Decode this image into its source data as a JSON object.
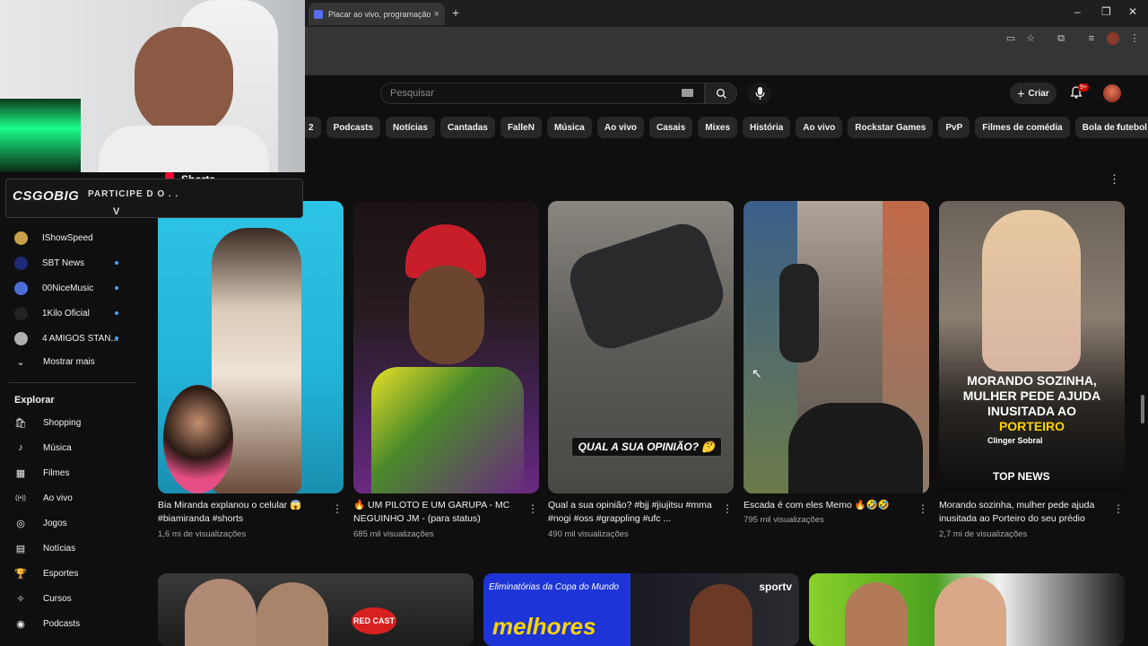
{
  "browser": {
    "tab_title": "Placar ao vivo, programação &",
    "tab_close": "×",
    "new_tab": "+",
    "window_controls": [
      "–",
      "❐",
      "✕"
    ]
  },
  "header": {
    "search_placeholder": "Pesquisar",
    "create_label": "Criar",
    "notification_count": "9+"
  },
  "chips": [
    "2",
    "Podcasts",
    "Notícias",
    "Cantadas",
    "FalleN",
    "Música",
    "Ao vivo",
    "Casais",
    "Mixes",
    "História",
    "Ao vivo",
    "Rockstar Games",
    "PvP",
    "Filmes de comédia",
    "Bola de futebol"
  ],
  "sidebar": {
    "subscriptions": [
      {
        "name": "IShowSpeed",
        "color": "#c9a04a",
        "dot": false
      },
      {
        "name": "SBT News",
        "color": "#1e2a78",
        "dot": true
      },
      {
        "name": "00NiceMusic",
        "color": "#4a6fd8",
        "dot": true
      },
      {
        "name": "1Kilo Oficial",
        "color": "#222222",
        "dot": true
      },
      {
        "name": "4 AMIGOS STAN...",
        "color": "#b0b0b0",
        "dot": true
      }
    ],
    "show_more": "Mostrar mais",
    "explore_heading": "Explorar",
    "explore_items": [
      {
        "label": "Shopping",
        "icon": "shopping-bag-icon",
        "glyph": "🛍"
      },
      {
        "label": "Música",
        "icon": "music-note-icon",
        "glyph": "♪"
      },
      {
        "label": "Filmes",
        "icon": "film-icon",
        "glyph": "▦"
      },
      {
        "label": "Ao vivo",
        "icon": "live-icon",
        "glyph": "((•))"
      },
      {
        "label": "Jogos",
        "icon": "gamepad-icon",
        "glyph": "◎"
      },
      {
        "label": "Notícias",
        "icon": "news-icon",
        "glyph": "▤"
      },
      {
        "label": "Esportes",
        "icon": "trophy-icon",
        "glyph": "🏆"
      },
      {
        "label": "Cursos",
        "icon": "bulb-icon",
        "glyph": "✧"
      },
      {
        "label": "Podcasts",
        "icon": "podcast-icon",
        "glyph": "◉"
      }
    ]
  },
  "shorts_section": {
    "title": "Shorts",
    "items": [
      {
        "title": "Bia Miranda explanou o celular 😱 #biamiranda #shorts",
        "views": "1,6 mi de visualizações",
        "overlay": ""
      },
      {
        "title": "🔥 UM PILOTO E UM GARUPA - MC NEGUINHO JM - (para status)",
        "views": "685 mil visualizações",
        "overlay": ""
      },
      {
        "title": "Qual a sua opinião? #bjj #jiujitsu #mma #nogi #oss #grappling #ufc ...",
        "views": "490 mil visualizações",
        "overlay": "QUAL A SUA OPINIÃO? 🤔"
      },
      {
        "title": "Escada é com eles Memo 🔥🤣🤣",
        "views": "795 mil visualizações",
        "overlay": ""
      },
      {
        "title": "Morando sozinha, mulher pede ajuda inusitada ao Porteiro do seu prédio",
        "views": "2,7 mi de visualizações",
        "overlay_white": "MORANDO SOZINHA, MULHER PEDE AJUDA INUSITADA AO",
        "overlay_yellow": "PORTEIRO",
        "channel_tag": "Clinger Sobral",
        "logo": "TOP NEWS"
      }
    ]
  },
  "bottom_row": {
    "elim_text": "Eliminatórias da Copa do Mundo",
    "elim_big": "melhores",
    "sportv": "sportv",
    "redcast": "RED CAST"
  },
  "webcam_overlay": {
    "logo": "CSGOBIG",
    "participe": "PARTICIPE D O . .",
    "letter": "V"
  },
  "colors": {
    "background": "#0f0f0f",
    "chip": "#272727",
    "accent_red": "#ff0033",
    "link_blue": "#3ea6ff"
  }
}
